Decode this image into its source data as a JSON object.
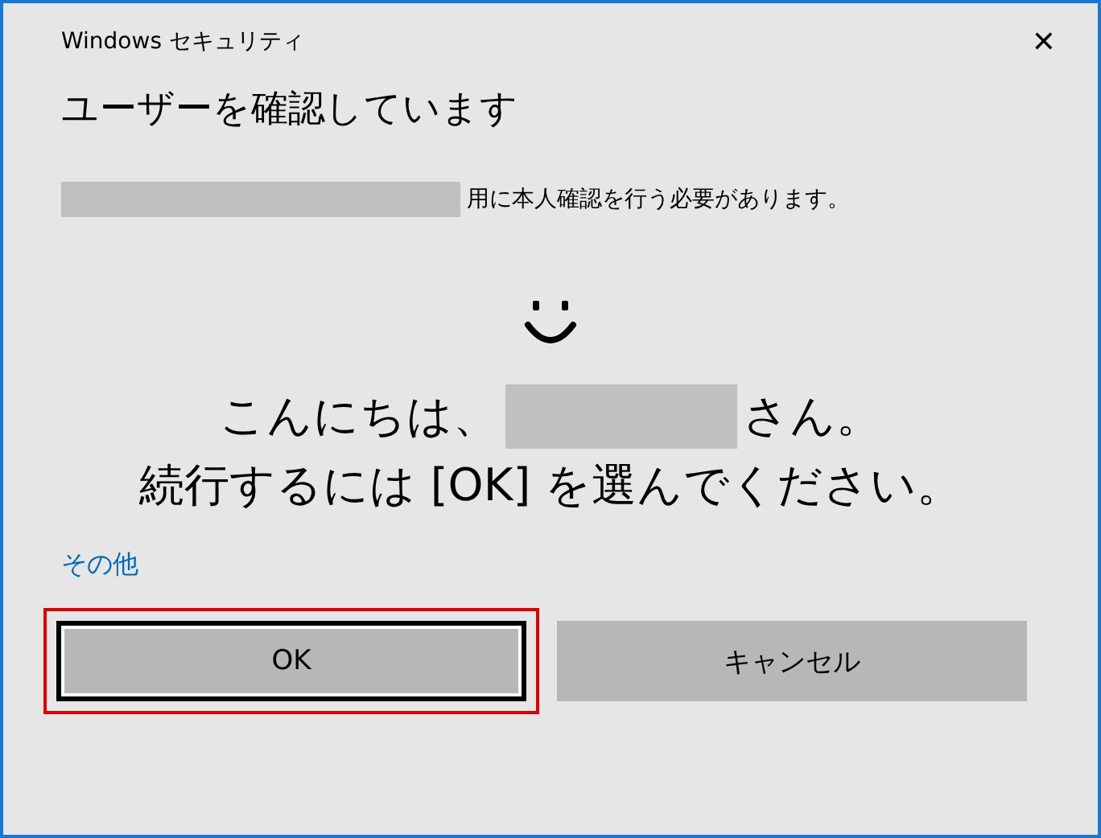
{
  "window": {
    "title": "Windows セキュリティ",
    "close": "✕"
  },
  "heading": "ユーザーを確認しています",
  "description": {
    "redacted": true,
    "text": "用に本人確認を行う必要があります。"
  },
  "greeting": {
    "before": "こんにちは、",
    "redacted": true,
    "after": "さん。",
    "instruction": "続行するには [OK] を選んでください。"
  },
  "more_link": "その他",
  "buttons": [
    {
      "label": "OK",
      "focused": true,
      "highlighted": true
    },
    {
      "label": "キャンセル",
      "focused": false,
      "highlighted": false
    }
  ]
}
